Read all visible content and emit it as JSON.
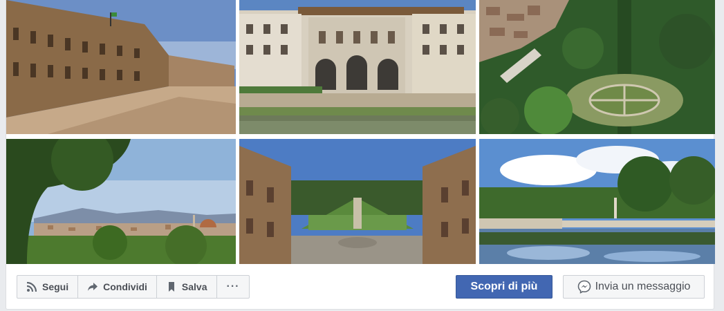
{
  "gallery": {
    "photos": [
      {
        "subject": "Palazzo Pitti facade and square"
      },
      {
        "subject": "Uffizi Gallery loggia by the river"
      },
      {
        "subject": "Aerial view of gardens with circular parterre"
      },
      {
        "subject": "Panorama of Florence with cathedral dome"
      },
      {
        "subject": "Palazzo Pitti courtyard overlooking Boboli Gardens"
      },
      {
        "subject": "Garden pond with balustrade and reflections"
      }
    ]
  },
  "actions": {
    "follow_label": "Segui",
    "share_label": "Condividi",
    "save_label": "Salva",
    "more_label": "···"
  },
  "cta": {
    "learn_more_label": "Scopri di più",
    "send_message_label": "Invia un messaggio"
  },
  "colors": {
    "primary": "#4267b2",
    "page_background": "#e9ebee",
    "secondary_text": "#4b4f56"
  },
  "icons": [
    "rss-icon",
    "share-arrow-icon",
    "bookmark-icon",
    "messenger-icon"
  ]
}
